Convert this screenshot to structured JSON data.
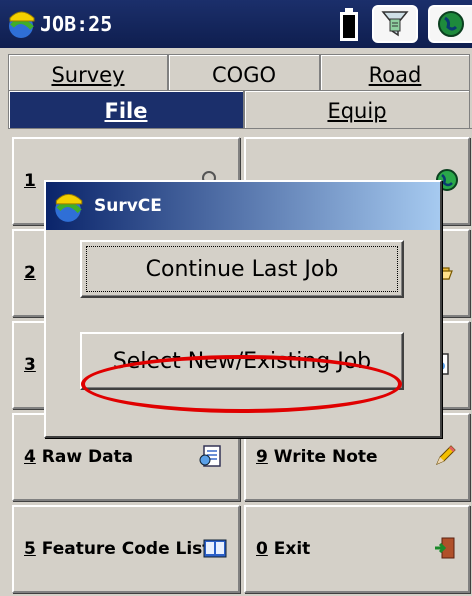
{
  "titlebar": {
    "title": "JOB:25",
    "icons": [
      "app-logo-icon",
      "battery-icon",
      "filter-icon",
      "globe-icon"
    ]
  },
  "tabs": {
    "top": [
      {
        "label": "Survey",
        "underline_first": true
      },
      {
        "label": "COGO",
        "underline_first": false
      },
      {
        "label": "Road",
        "underline_first": true
      }
    ],
    "bottom": [
      {
        "label": "File",
        "active": true
      },
      {
        "label": "Equip",
        "active": false
      }
    ]
  },
  "grid": {
    "left": [
      {
        "key": "1",
        "label": "",
        "icon": "zoom-icon"
      },
      {
        "key": "2",
        "label": "",
        "icon": ""
      },
      {
        "key": "3",
        "label": "",
        "icon": ""
      },
      {
        "key": "4",
        "label": "Raw Data",
        "icon": "raw-data-icon"
      },
      {
        "key": "5",
        "label": "Feature Code List",
        "icon": "book-icon"
      }
    ],
    "right": [
      {
        "key": "",
        "label": "",
        "icon": "globe-icon"
      },
      {
        "key": "",
        "label": "",
        "icon": "folder-open-icon"
      },
      {
        "key": "",
        "label": "",
        "icon": "document-icon"
      },
      {
        "key": "9",
        "label": "Write Note",
        "icon": "pencil-icon"
      },
      {
        "key": "0",
        "label": "Exit",
        "icon": "exit-door-icon"
      }
    ]
  },
  "dialog": {
    "title": "SurvCE",
    "continue_label": "Continue Last Job",
    "select_label": "Select New/Existing Job",
    "highlight_color": "#e00000"
  },
  "colors": {
    "titlebar": "#1b2f6b",
    "active_tab": "#1b2f6b",
    "dialog_title_start": "#0a246a",
    "dialog_title_end": "#a6caf0"
  }
}
